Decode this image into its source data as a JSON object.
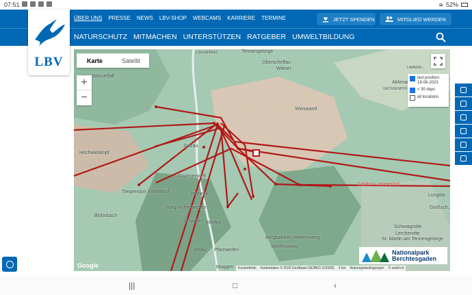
{
  "status": {
    "time": "07:51",
    "battery": "52%"
  },
  "topmenu": [
    "ÜBER UNS",
    "PRESSE",
    "NEWS",
    "LBV-SHOP",
    "WEBCAMS",
    "KARRIERE",
    "TERMINE"
  ],
  "buttons": {
    "spenden": "JETZT SPENDEN",
    "mitglied": "MITGLIED WERDEN"
  },
  "nav": [
    "NATURSCHUTZ",
    "MITMACHEN",
    "UNTERSTÜTZEN",
    "RATGEBER",
    "UMWELTBILDUNG"
  ],
  "logo": {
    "text": "LBV"
  },
  "map": {
    "toggle": {
      "karte": "Karte",
      "satellit": "Satellit"
    },
    "zoom_in": "+",
    "zoom_out": "−",
    "legend": {
      "last_position": "last position:",
      "last_date": "18-06-2023",
      "days": "< 30 days",
      "all": "all locations"
    },
    "places": [
      {
        "id": "tennengebirge",
        "label": "Tennengebirge"
      },
      {
        "id": "oberscheffau",
        "label": "Oberscheffau"
      },
      {
        "id": "wieser",
        "label": "Wieser"
      },
      {
        "id": "lammerhof",
        "label": "LAMMER..."
      },
      {
        "id": "abtenau",
        "label": "Abtenau"
      },
      {
        "id": "grossenhof",
        "label": "GROSSENHOF"
      },
      {
        "id": "wasserfall",
        "label": "...ntau Wasserfall"
      },
      {
        "id": "wieswand",
        "label": "Wieswand"
      },
      {
        "id": "sulzau",
        "label": "Sulzau"
      },
      {
        "id": "hochwieskopf",
        "label": "Hochwieskopf"
      },
      {
        "id": "eisriesenwelt",
        "label": "Eisriesenwelt"
      },
      {
        "id": "fohlenhof",
        "label": "Tierpension Fohlenhof"
      },
      {
        "id": "bluhnbach",
        "label": "Blühnbach"
      },
      {
        "id": "tenneck",
        "label": "Tenneck"
      },
      {
        "id": "hohenwerfen",
        "label": "Burg Hohenwerfen"
      },
      {
        "id": "scharten",
        "label": "Scharten"
      },
      {
        "id": "werfen",
        "label": "Werfen"
      },
      {
        "id": "imlau",
        "label": "Imlau"
      },
      {
        "id": "pfarrwerfen",
        "label": "Pfarrwerfen"
      },
      {
        "id": "maggen",
        "label": "Maggen"
      },
      {
        "id": "werfenweng",
        "label": "Werfenweng"
      },
      {
        "id": "bergbahnen",
        "label": "Bergbahnen Werfenweng"
      },
      {
        "id": "lungotz",
        "label": "Lungötz"
      },
      {
        "id": "grossch",
        "label": "Großsch..."
      },
      {
        "id": "schwaigrotte",
        "label": "Schwaigrotte"
      },
      {
        "id": "lercherotte",
        "label": "Lercherotte"
      },
      {
        "id": "stmartin",
        "label": "St. Martin am Tennengebirge"
      },
      {
        "id": "lammenhof",
        "label": "Gasthof Lammerhof"
      },
      {
        "id": "luegwinkel",
        "label": "LUEGWINKEL"
      }
    ],
    "np": {
      "line1": "Nationalpark",
      "line2": "Berchtesgaden",
      "small": "LBV"
    },
    "google": "Google",
    "attribution": [
      "Kurzbefehle",
      "Kartendaten © 2023 GeoBasis-DE/BKG (©2009)",
      "2 km",
      "Nutzungsbedingungen",
      "© swild.ch"
    ]
  },
  "colors": {
    "brand": "#0068b4",
    "track": "#b01818"
  },
  "icons": [
    "hand-heart-icon",
    "people-icon",
    "search-icon",
    "facebook-icon",
    "twitter-icon",
    "flickr-icon",
    "instagram-icon",
    "pinterest-icon",
    "youtube-icon",
    "cookie-icon"
  ]
}
